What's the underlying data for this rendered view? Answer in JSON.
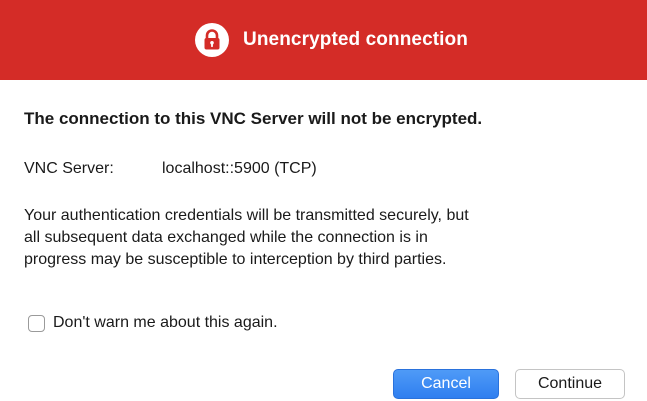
{
  "banner": {
    "title": "Unencrypted connection",
    "icon": "lock-icon",
    "color": "#d42c27"
  },
  "main": {
    "heading": "The connection to this VNC Server will not be encrypted.",
    "server_label": "VNC Server:",
    "server_value": "localhost::5900 (TCP)",
    "body_line1": "Your authentication credentials will be transmitted securely, but",
    "body_line2": "all subsequent data exchanged while the connection is in",
    "body_line3": "progress may be susceptible to interception by third parties."
  },
  "checkbox": {
    "label": "Don't warn me about this again.",
    "checked": false
  },
  "buttons": {
    "cancel_label": "Cancel",
    "continue_label": "Continue",
    "primary_color": "#2f7ff0"
  }
}
